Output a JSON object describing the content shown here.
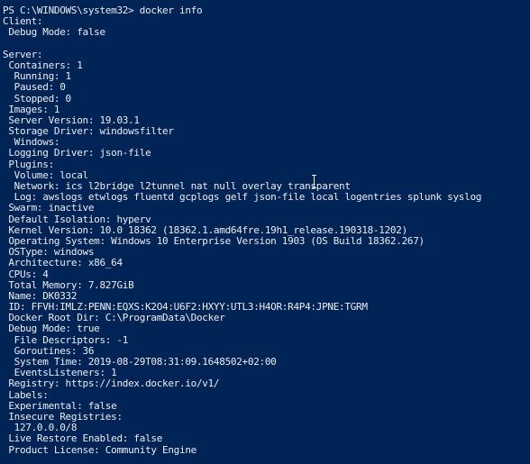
{
  "terminal": {
    "lines": [
      "PS C:\\WINDOWS\\system32> docker info",
      "Client:",
      " Debug Mode: false",
      "",
      "Server:",
      " Containers: 1",
      "  Running: 1",
      "  Paused: 0",
      "  Stopped: 0",
      " Images: 1",
      " Server Version: 19.03.1",
      " Storage Driver: windowsfilter",
      "  Windows:",
      " Logging Driver: json-file",
      " Plugins:",
      "  Volume: local",
      "  Network: ics l2bridge l2tunnel nat null overlay transparent",
      "  Log: awslogs etwlogs fluentd gcplogs gelf json-file local logentries splunk syslog",
      " Swarm: inactive",
      " Default Isolation: hyperv",
      " Kernel Version: 10.0 18362 (18362.1.amd64fre.19h1_release.190318-1202)",
      " Operating System: Windows 10 Enterprise Version 1903 (OS Build 18362.267)",
      " OSType: windows",
      " Architecture: x86_64",
      " CPUs: 4",
      " Total Memory: 7.827GiB",
      " Name: DK0332",
      " ID: FFVH:IMLZ:PENN:EQXS:K2O4:U6F2:HXYY:UTL3:H4OR:R4P4:JPNE:TGRM",
      " Docker Root Dir: C:\\ProgramData\\Docker",
      " Debug Mode: true",
      "  File Descriptors: -1",
      "  Goroutines: 36",
      "  System Time: 2019-08-29T08:31:09.1648502+02:00",
      "  EventsListeners: 1",
      " Registry: https://index.docker.io/v1/",
      " Labels:",
      " Experimental: false",
      " Insecure Registries:",
      "  127.0.0.0/8",
      " Live Restore Enabled: false",
      " Product License: Community Engine"
    ],
    "colors": {
      "background": "#012456",
      "foreground": "#eeedf0"
    },
    "cursor_icon": "text-cursor-icon"
  }
}
